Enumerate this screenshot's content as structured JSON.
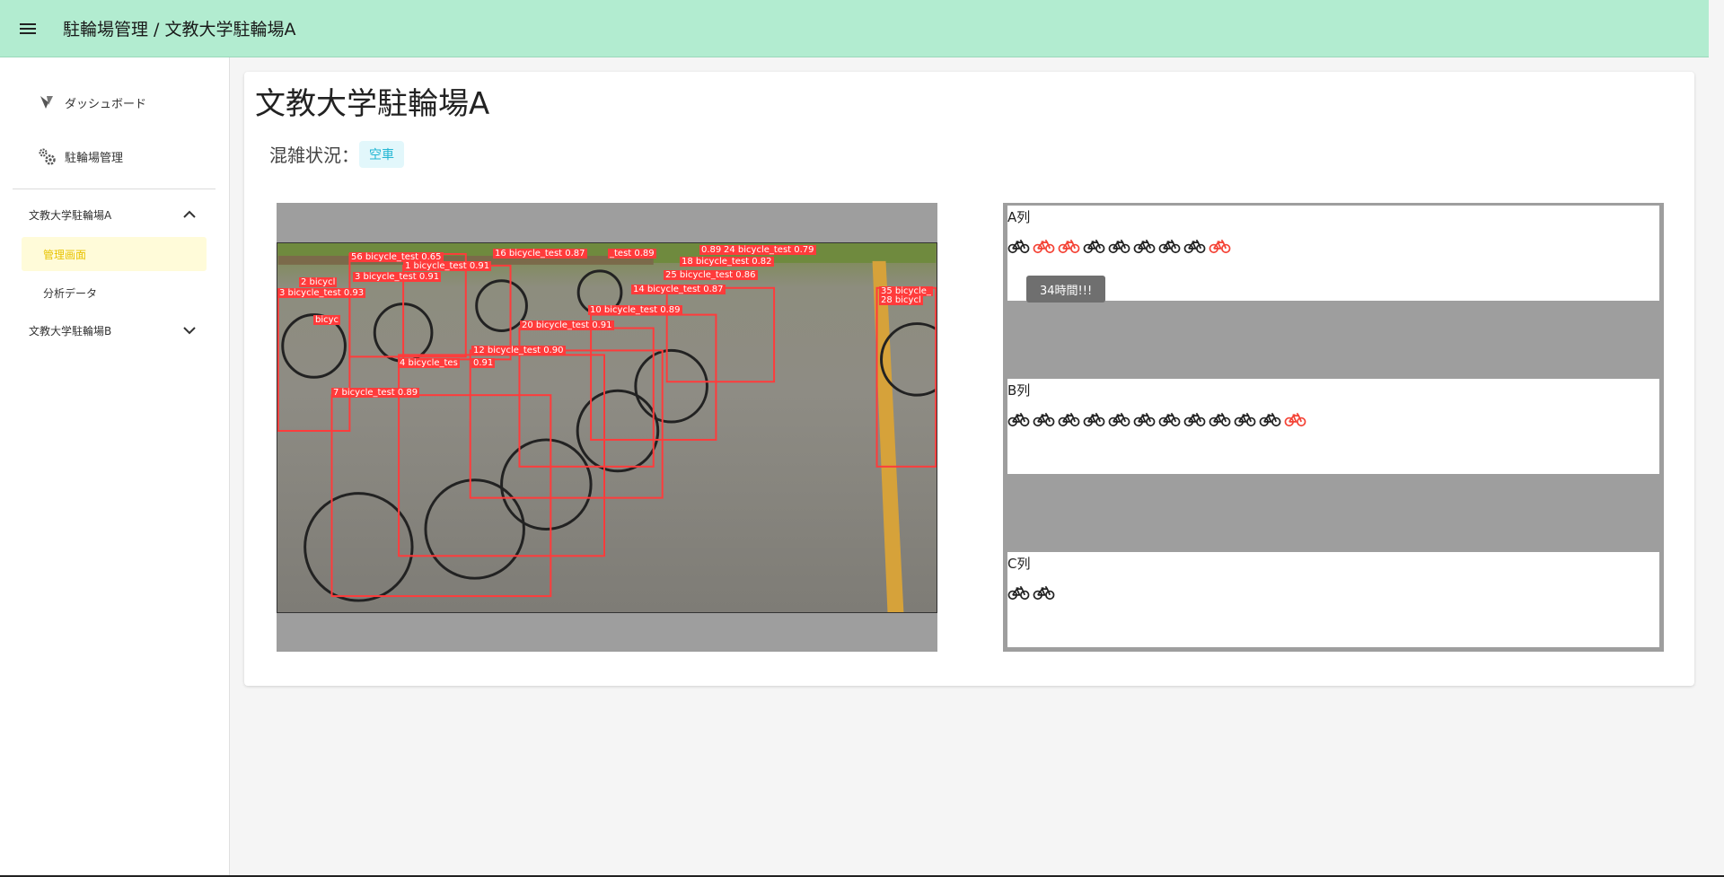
{
  "appbar": {
    "title": "駐輪場管理 / 文教大学駐輪場A",
    "menu_icon": "menu-icon"
  },
  "sidebar": {
    "items": [
      {
        "label": "ダッシュボード",
        "icon": "vuetify-logo-icon"
      },
      {
        "label": "駐輪場管理",
        "icon": "gears-icon"
      }
    ],
    "groups": [
      {
        "label": "文教大学駐輪場A",
        "expanded": true,
        "children": [
          {
            "label": "管理画面",
            "active": true
          },
          {
            "label": "分析データ",
            "active": false
          }
        ]
      },
      {
        "label": "文教大学駐輪場B",
        "expanded": false,
        "children": []
      }
    ]
  },
  "main": {
    "title": "文教大学駐輪場A",
    "status_label": "混雑状況：",
    "status_value": "空車",
    "camera": {
      "detections": [
        "56 bicycle_test 0.65",
        "16 bicycle_test 0.87",
        "_test 0.89",
        "0.89",
        "24 bicycle_test 0.79",
        "1 bicycle_test 0.91",
        "18 bicycle_test 0.82",
        "2 bicycl",
        "3 bicycle_test 0.91",
        "25 bicycle_test 0.86",
        "3 bicycle_test 0.93",
        "14 bicycle_test 0.87",
        "10 bicycle_test 0.89",
        "20 bicycle_test 0.91",
        "12 bicycle_test 0.90",
        "4 bicycle_tes",
        "0.91",
        "7 bicycle_test 0.89",
        "35 bicycle_",
        "28 bicycl",
        "bicyc"
      ]
    },
    "rows": [
      {
        "title": "A列",
        "bikes": [
          "black",
          "red",
          "red",
          "black",
          "black",
          "black",
          "black",
          "black",
          "red"
        ],
        "tooltip": "34時間!!!"
      },
      {
        "title": "B列",
        "bikes": [
          "black",
          "black",
          "black",
          "black",
          "black",
          "black",
          "black",
          "black",
          "black",
          "black",
          "black",
          "red"
        ]
      },
      {
        "title": "C列",
        "bikes": [
          "black",
          "black"
        ]
      }
    ]
  },
  "colors": {
    "appbar": "#b2ecd0",
    "active": "#e8c300",
    "bike_alert": "#f44336",
    "chip_text": "#22b6d3"
  }
}
